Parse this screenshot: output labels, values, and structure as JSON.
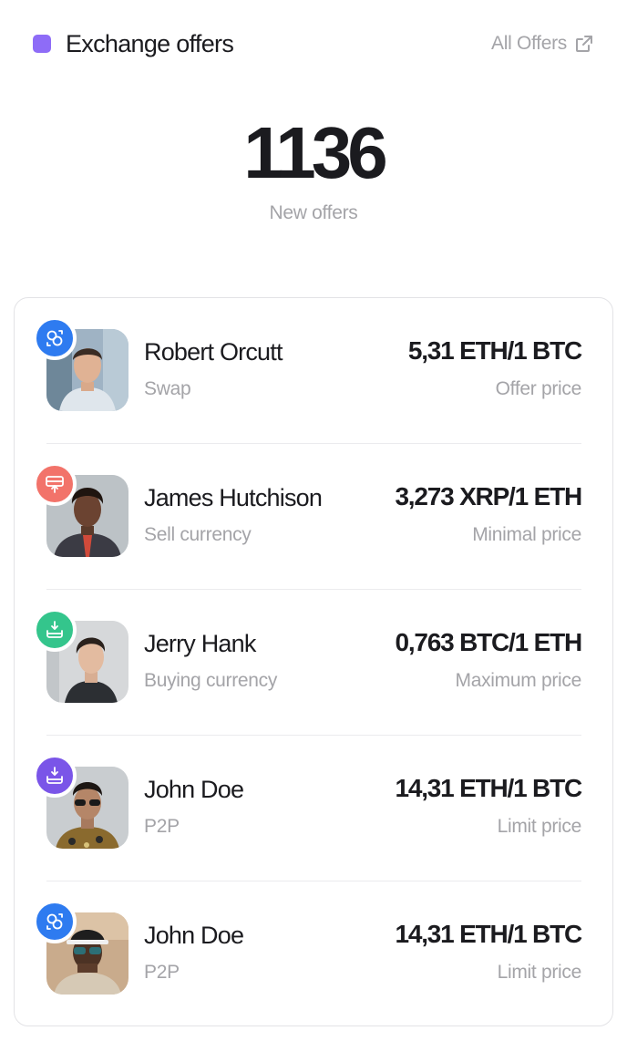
{
  "header": {
    "title": "Exchange offers",
    "link_label": "All Offers",
    "link_icon": "external-link-icon",
    "accent": "#8e6cf7"
  },
  "summary": {
    "count": "1136",
    "label": "New offers"
  },
  "offers": [
    {
      "name": "Robert Orcutt",
      "type": "Swap",
      "price": "5,31 ETH/1 BTC",
      "price_label": "Offer price",
      "badge_icon": "swap-icon",
      "badge_color": "#2e7bf0"
    },
    {
      "name": "James Hutchison",
      "type": "Sell currency",
      "price": "3,273 XRP/1 ETH",
      "price_label": "Minimal price",
      "badge_icon": "upload-tray-icon",
      "badge_color": "#f2736a"
    },
    {
      "name": "Jerry Hank",
      "type": "Buying currency",
      "price": "0,763 BTC/1 ETH",
      "price_label": "Maximum price",
      "badge_icon": "download-tray-icon",
      "badge_color": "#34c58c"
    },
    {
      "name": "John Doe",
      "type": "P2P",
      "price": "14,31 ETH/1 BTC",
      "price_label": "Limit price",
      "badge_icon": "download-tray-icon",
      "badge_color": "#7a55e8"
    },
    {
      "name": "John Doe",
      "type": "P2P",
      "price": "14,31 ETH/1 BTC",
      "price_label": "Limit price",
      "badge_icon": "swap-icon",
      "badge_color": "#2e7bf0"
    }
  ]
}
